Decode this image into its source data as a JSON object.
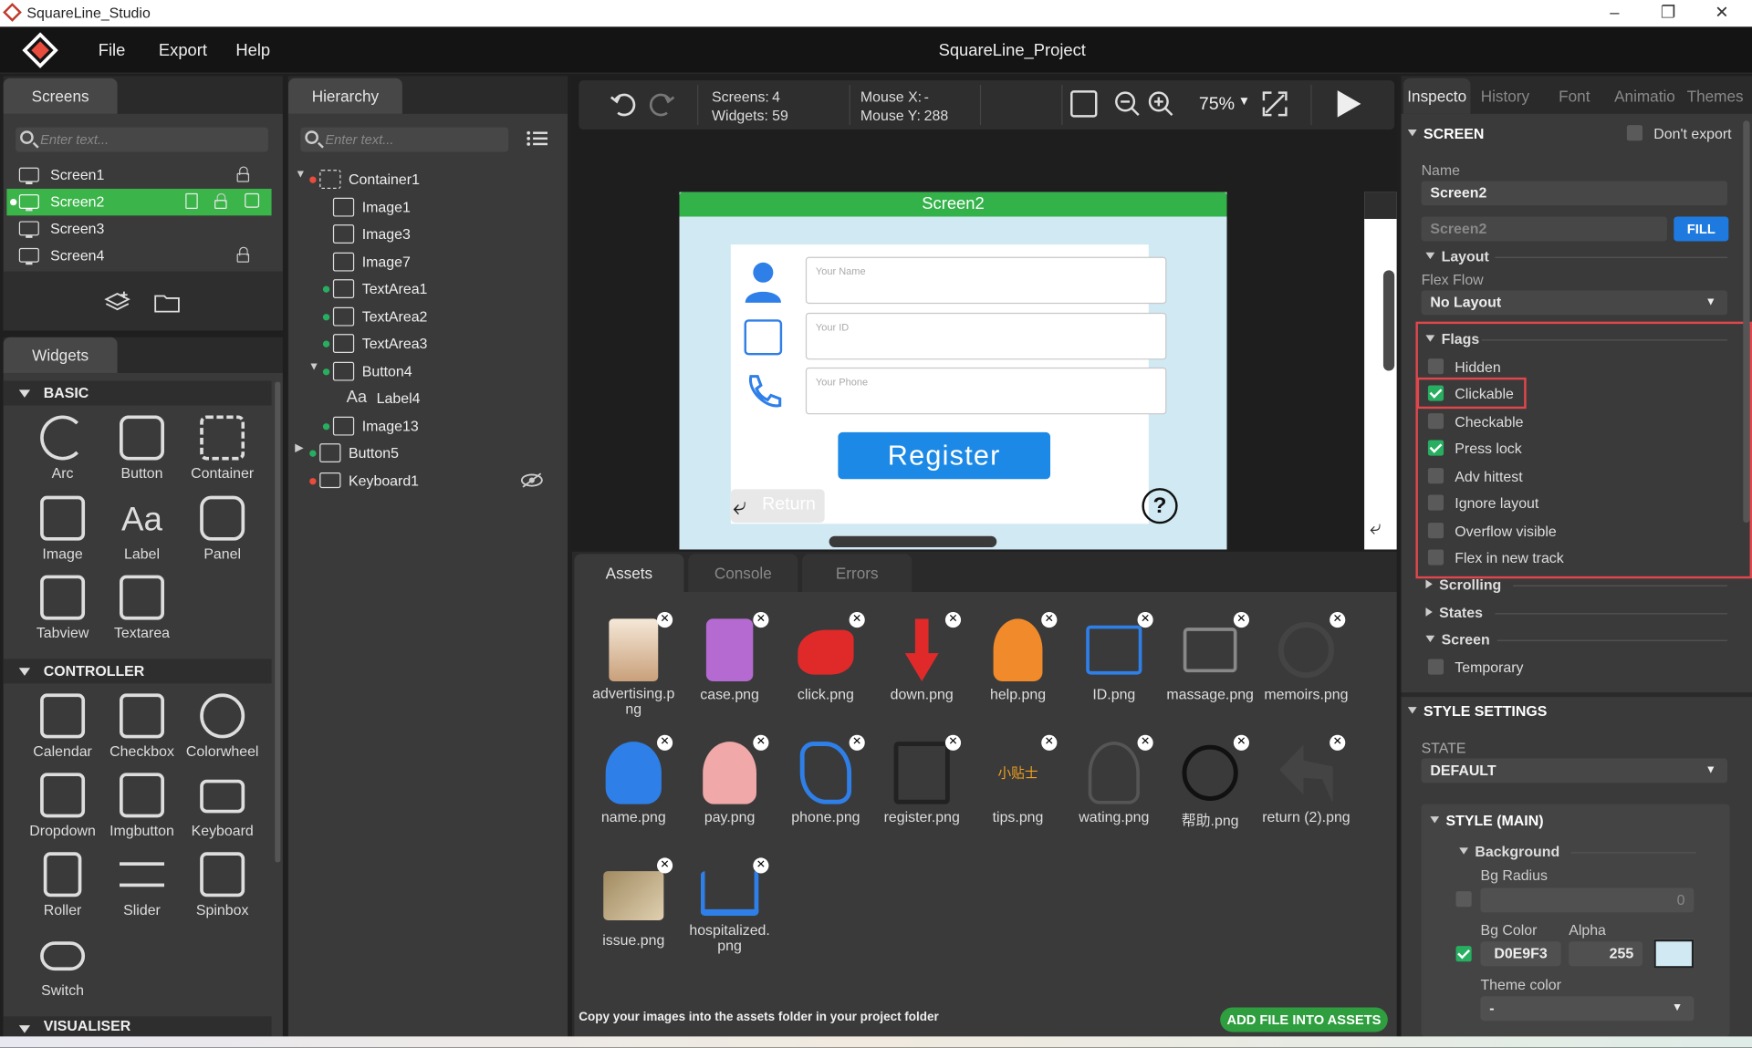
{
  "app": {
    "window_title": "SquareLine_Studio",
    "project_title": "SquareLine_Project"
  },
  "menu": [
    "File",
    "Export",
    "Help"
  ],
  "screens_panel": {
    "tab": "Screens",
    "search_placeholder": "Enter text...",
    "items": [
      "Screen1",
      "Screen2",
      "Screen3",
      "Screen4"
    ],
    "selected": "Screen2"
  },
  "widgets_panel": {
    "tab": "Widgets",
    "sections": [
      {
        "title": "BASIC",
        "items": [
          "Arc",
          "Button",
          "Container",
          "Image",
          "Label",
          "Panel",
          "Tabview",
          "Textarea"
        ]
      },
      {
        "title": "CONTROLLER",
        "items": [
          "Calendar",
          "Checkbox",
          "Colorwheel",
          "Dropdown",
          "Imgbutton",
          "Keyboard",
          "Roller",
          "Slider",
          "Spinbox",
          "Switch"
        ]
      },
      {
        "title": "VISUALISER"
      }
    ]
  },
  "hierarchy": {
    "tab": "Hierarchy",
    "search_placeholder": "Enter text...",
    "items": [
      "Container1",
      "Image1",
      "Image3",
      "Image7",
      "TextArea1",
      "TextArea2",
      "TextArea3",
      "Button4",
      "Label4",
      "Image13",
      "Button5",
      "Keyboard1"
    ]
  },
  "toolbar": {
    "screens_label": "Screens:",
    "screens_value": "4",
    "widgets_label": "Widgets:",
    "widgets_value": "59",
    "mousex_label": "Mouse X:",
    "mousex_value": "-",
    "mousey_label": "Mouse Y:",
    "mousey_value": "288",
    "zoom": "75%"
  },
  "canvas": {
    "screen_name": "Screen2",
    "field_name": "Your Name",
    "field_id": "Your ID",
    "field_phone": "Your Phone",
    "register": "Register",
    "return": "Return",
    "help_glyph": "?"
  },
  "bottom_tabs": [
    "Assets",
    "Console",
    "Errors"
  ],
  "assets": [
    "advertising.png",
    "case.png",
    "click.png",
    "down.png",
    "help.png",
    "ID.png",
    "massage.png",
    "memoirs.png",
    "name.png",
    "pay.png",
    "phone.png",
    "register.png",
    "tips.png",
    "wating.png",
    "帮助.png",
    "return (2).png",
    "issue.png",
    "hospitalized.png"
  ],
  "assets_tips_text": "小贴士",
  "assets_footer": {
    "hint": "Copy your images into the assets folder in your project folder",
    "button": "ADD FILE INTO ASSETS"
  },
  "inspector": {
    "tabs": [
      "Inspecto",
      "History",
      "Font",
      "Animatio",
      "Themes"
    ],
    "screen_header": "SCREEN",
    "dont_export": "Don't export",
    "name_label": "Name",
    "name_value": "Screen2",
    "name_value2": "Screen2",
    "fill_button": "FILL",
    "layout": "Layout",
    "flex_flow_label": "Flex Flow",
    "flex_flow_value": "No Layout",
    "flags_title": "Flags",
    "flags": [
      {
        "label": "Hidden",
        "checked": false
      },
      {
        "label": "Clickable",
        "checked": true
      },
      {
        "label": "Checkable",
        "checked": false
      },
      {
        "label": "Press lock",
        "checked": true
      },
      {
        "label": "Adv hittest",
        "checked": false
      },
      {
        "label": "Ignore layout",
        "checked": false
      },
      {
        "label": "Overflow visible",
        "checked": false
      },
      {
        "label": "Flex in new track",
        "checked": false
      }
    ],
    "scrolling": "Scrolling",
    "states": "States",
    "screen_sub": "Screen",
    "temporary": "Temporary",
    "style_settings": "STYLE SETTINGS",
    "state_label": "STATE",
    "state_value": "DEFAULT",
    "style_main": "STYLE (MAIN)",
    "background": "Background",
    "bg_radius": "Bg Radius",
    "bg_radius_value": "0",
    "bg_color": "Bg Color",
    "alpha": "Alpha",
    "bg_color_value": "D0E9F3",
    "alpha_value": "255",
    "bg_swatch": "#D0E9F3",
    "theme_color": "Theme color",
    "theme_color_value": "-"
  },
  "colors": {
    "accent_green": "#33b249",
    "register_blue": "#1c89e6",
    "highlight_red": "#e0474c"
  }
}
